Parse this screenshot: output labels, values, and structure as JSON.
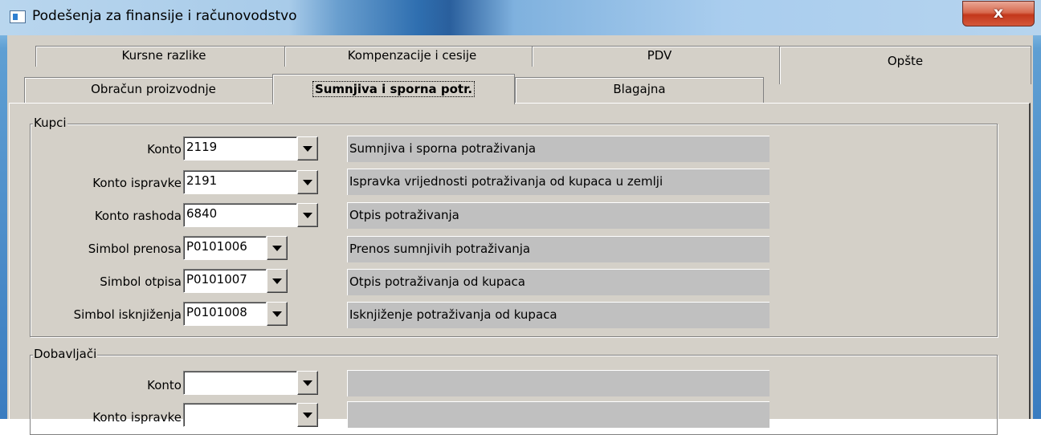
{
  "window": {
    "title": "Podešenja za finansije i računovodstvo",
    "close_label": "x"
  },
  "tabs": {
    "row1": [
      "Kursne razlike",
      "Kompenzacije i cesije",
      "PDV",
      "Opšte"
    ],
    "row2": [
      "Obračun proizvodnje",
      "Sumnjiva i sporna potr.",
      "Blagajna"
    ],
    "active": "Sumnjiva i sporna potr."
  },
  "kupci": {
    "legend": "Kupci",
    "rows": [
      {
        "label": "Konto",
        "value": "2119",
        "description": "Sumnjiva i sporna potraživanja"
      },
      {
        "label": "Konto ispravke",
        "value": "2191",
        "description": "Ispravka vrijednosti potraživanja od kupaca u zemlji"
      },
      {
        "label": "Konto rashoda",
        "value": "6840",
        "description": "Otpis potraživanja"
      },
      {
        "label": "Simbol prenosa",
        "value": "P0101006",
        "description": "Prenos sumnjivih potraživanja"
      },
      {
        "label": "Simbol otpisa",
        "value": "P0101007",
        "description": "Otpis potraživanja od kupaca"
      },
      {
        "label": "Simbol isknjiženja",
        "value": "P0101008",
        "description": "Isknjiženje potraživanja od kupaca"
      }
    ]
  },
  "dobavljaci": {
    "legend": "Dobavljači",
    "rows": [
      {
        "label": "Konto",
        "value": "",
        "description": ""
      },
      {
        "label": "Konto ispravke",
        "value": "",
        "description": ""
      }
    ]
  },
  "icons": {
    "window": "app-window-icon",
    "close": "close-icon",
    "dropdown": "dropdown-arrow-icon"
  },
  "colors": {
    "face": "#d4d0c8",
    "desc_bg": "#c0c0c0",
    "close": "#c3371b"
  }
}
